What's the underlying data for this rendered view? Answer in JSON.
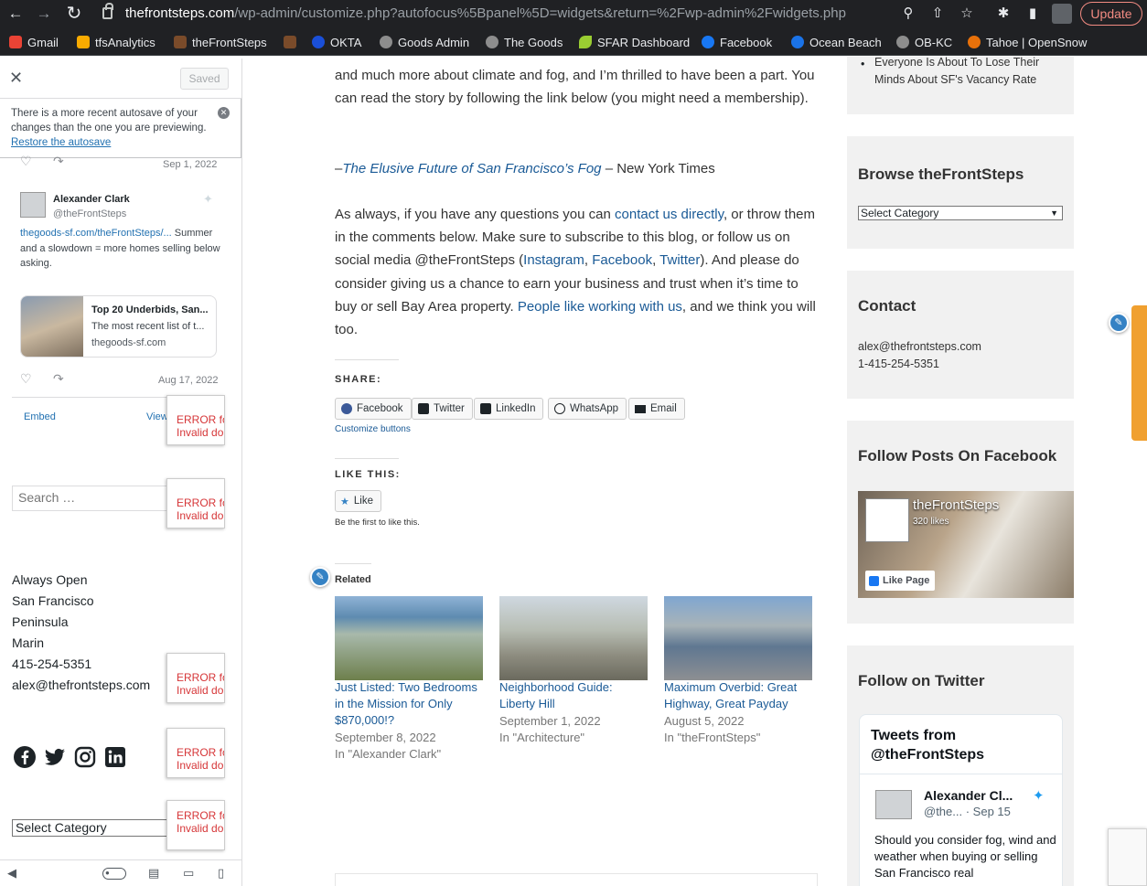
{
  "browser": {
    "url_host": "thefrontsteps.com",
    "url_path": "/wp-admin/customize.php?autofocus%5Bpanel%5D=widgets&return=%2Fwp-admin%2Fwidgets.php",
    "update_label": "Update"
  },
  "bookmarks": [
    {
      "label": "Gmail",
      "color": "#ea4335"
    },
    {
      "label": "tfsAnalytics",
      "color": "#f9ab00"
    },
    {
      "label": "theFrontSteps",
      "color": "#7a4b2a"
    },
    {
      "label": "",
      "color": "#7a4b2a"
    },
    {
      "label": "OKTA",
      "color": "#1a4fd8"
    },
    {
      "label": "Goods Admin",
      "color": "#8d8d8d"
    },
    {
      "label": "The Goods",
      "color": "#8d8d8d"
    },
    {
      "label": "SFAR Dashboard",
      "color": "#9acd32"
    },
    {
      "label": "Facebook",
      "color": "#1877f2"
    },
    {
      "label": "Ocean Beach",
      "color": "#1a73e8"
    },
    {
      "label": "OB-KC",
      "color": "#8d8d8d"
    },
    {
      "label": "Tahoe | OpenSnow",
      "color": "#e8710a"
    }
  ],
  "customizer": {
    "saved_label": "Saved",
    "notice_text": "There is a more recent autosave of your changes than the one you are previewing.",
    "notice_link": "Restore the autosave",
    "tweet_date_1": "Sep 1, 2022",
    "tweet_name": "Alexander Clark",
    "tweet_handle": "@theFrontSteps",
    "tweet_link": "thegoods-sf.com/theFrontSteps/...",
    "tweet_text": "Summer and a slowdown = more homes selling below asking.",
    "card_title": "Top 20 Underbids, San...",
    "card_desc": "The most recent list of t...",
    "card_domain": "thegoods-sf.com",
    "tweet_date_2": "Aug 17, 2022",
    "embed_label": "Embed",
    "view_label": "View",
    "error_line1": "ERROR fo",
    "error_line2": "Invalid do",
    "search_placeholder": "Search …",
    "address": [
      "Always Open",
      "San Francisco",
      "Peninsula",
      "Marin",
      "415-254-5351",
      "alex@thefrontsteps.com"
    ],
    "select_category": "Select Category"
  },
  "article": {
    "p1": "and much more about climate and fog, and I’m thrilled to have been a part. You can read the story by following the link below (you might need a membership).",
    "source_prefix": "–",
    "source_link": "The Elusive Future of San Francisco’s Fog",
    "source_suffix": " – New York Times",
    "p2_a": "As always, if you have any questions you can ",
    "p2_link1": "contact us directly",
    "p2_b": ", or throw them in the comments below. Make sure to subscribe to this blog, or follow us on social media @theFrontSteps (",
    "p2_link2": "Instagram",
    "p2_c": ", ",
    "p2_link3": "Facebook",
    "p2_d": ", ",
    "p2_link4": "Twitter",
    "p2_e": "). And please do consider giving us a chance to earn your business and trust when it’s time to buy or sell Bay Area property. ",
    "p2_link5": "People like working with us",
    "p2_f": ", and we think you will too.",
    "share_label": "SHARE:",
    "share_buttons": [
      "Facebook",
      "Twitter",
      "LinkedIn",
      "WhatsApp",
      "Email"
    ],
    "customize_buttons": "Customize buttons",
    "like_label": "LIKE THIS:",
    "like_button": "Like",
    "like_first": "Be the first to like this.",
    "related_label": "Related",
    "related": [
      {
        "title": "Just Listed: Two Bedrooms in the Mission for Only $870,000!?",
        "date": "September 8, 2022",
        "cat": "In \"Alexander Clark\""
      },
      {
        "title": "Neighborhood Guide: Liberty Hill",
        "date": "September 1, 2022",
        "cat": "In \"Architecture\""
      },
      {
        "title": "Maximum Overbid: Great Highway, Great Payday",
        "date": "August 5, 2022",
        "cat": "In \"theFrontSteps\""
      }
    ]
  },
  "sidebar": {
    "top_item": "Everyone Is About To Lose Their Minds About SF's Vacancy Rate",
    "browse_title": "Browse theFrontSteps",
    "browse_select": "Select Category",
    "contact_title": "Contact",
    "contact_email": "alex@thefrontsteps.com",
    "contact_phone": "1-415-254-5351",
    "fb_title": "Follow Posts On Facebook",
    "fb_page": "theFrontSteps",
    "fb_likes": "320 likes",
    "fb_like_page": "Like Page",
    "tw_title": "Follow on Twitter",
    "tw_header": "Tweets from @theFrontSteps",
    "tw_name": "Alexander Cl...",
    "tw_handle": "@the...",
    "tw_date": "· Sep 15",
    "tw_text": "Should you consider fog, wind and weather when buying or selling San Francisco real"
  }
}
